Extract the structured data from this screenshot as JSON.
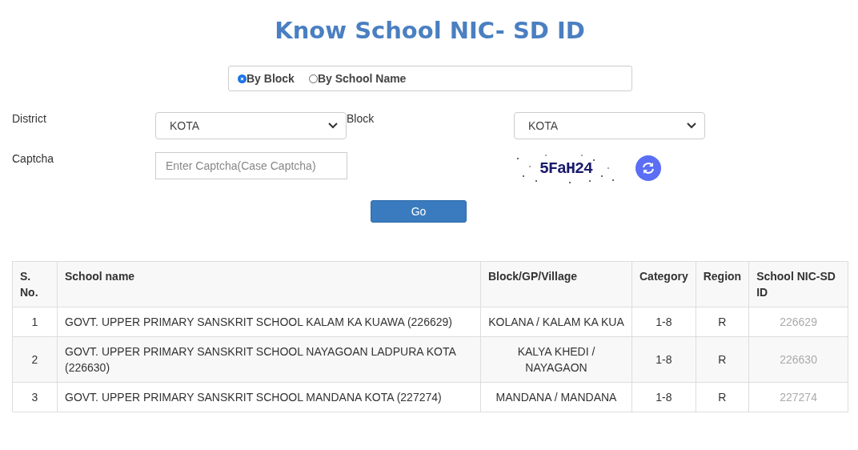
{
  "title": "Know School NIC- SD ID",
  "search_mode": [
    {
      "label": "By Block",
      "selected": true
    },
    {
      "label": "By School Name",
      "selected": false
    }
  ],
  "form": {
    "district_label": "District",
    "district_value": "KOTA",
    "block_label": "Block",
    "block_value": "KOTA",
    "captcha_label": "Captcha",
    "captcha_placeholder": "Enter Captcha(Case Captcha)",
    "captcha_text": "5FaH24"
  },
  "go_button": "Go",
  "table": {
    "columns": [
      "S. No.",
      "School name",
      "Block/GP/Village",
      "Category",
      "Region",
      "School NIC-SD ID"
    ],
    "rows": [
      [
        "1",
        "GOVT. UPPER PRIMARY SANSKRIT SCHOOL KALAM KA KUAWA (226629)",
        "KOLANA / KALAM KA KUA",
        "1-8",
        "R",
        "226629"
      ],
      [
        "2",
        "GOVT. UPPER PRIMARY SANSKRIT SCHOOL NAYAGOAN LADPURA KOTA (226630)",
        "KALYA KHEDI / NAYAGAON",
        "1-8",
        "R",
        "226630"
      ],
      [
        "3",
        "GOVT. UPPER PRIMARY SANSKRIT SCHOOL MANDANA KOTA (227274)",
        "MANDANA / MANDANA",
        "1-8",
        "R",
        "227274"
      ]
    ]
  }
}
